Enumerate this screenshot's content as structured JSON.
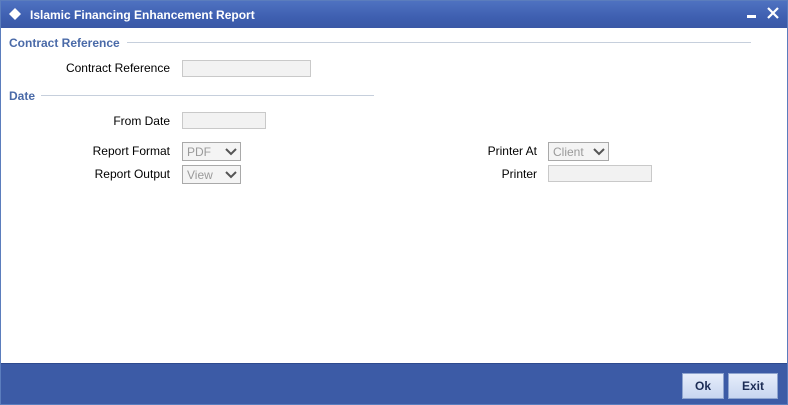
{
  "window": {
    "title": "Islamic Financing Enhancement Report",
    "title_icon": "diamond-icon",
    "minimize_icon": "minimize-icon",
    "close_icon": "close-icon"
  },
  "sections": {
    "contract_reference": {
      "title": "Contract Reference",
      "field_label": "Contract Reference",
      "field_value": ""
    },
    "date": {
      "title": "Date",
      "from_date_label": "From Date",
      "from_date_value": ""
    }
  },
  "report_options": {
    "report_format_label": "Report Format",
    "report_format_value": "PDF",
    "report_output_label": "Report Output",
    "report_output_value": "View",
    "printer_at_label": "Printer At",
    "printer_at_value": "Client",
    "printer_label": "Printer",
    "printer_value": ""
  },
  "footer": {
    "ok_label": "Ok",
    "exit_label": "Exit"
  },
  "colors": {
    "titlebar": "#3e5fb0",
    "footer": "#3c5ba6",
    "section_title": "#4a6aa8"
  }
}
